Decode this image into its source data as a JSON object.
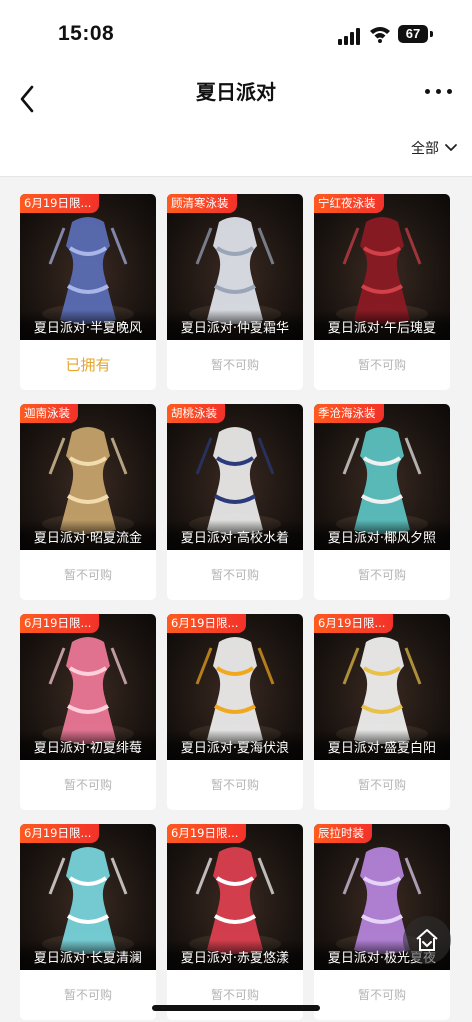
{
  "status_bar": {
    "time": "15:08",
    "battery": "67"
  },
  "header": {
    "title": "夏日派对"
  },
  "filter": {
    "label": "全部"
  },
  "items": [
    {
      "tag": "6月19日限...",
      "name": "夏日派对·半夏晚风",
      "status": "已拥有",
      "owned": true,
      "outfit": "#5b6fb8",
      "accent": "#a9b6e8"
    },
    {
      "tag": "顾清寒泳装",
      "name": "夏日派对·仲夏霜华",
      "status": "暂不可购",
      "owned": false,
      "outfit": "#e2e6ee",
      "accent": "#9aa6b8"
    },
    {
      "tag": "宁红夜泳装",
      "name": "夏日派对·午后瑰夏",
      "status": "暂不可购",
      "owned": false,
      "outfit": "#8e1a24",
      "accent": "#d2404a"
    },
    {
      "tag": "迦南泳装",
      "name": "夏日派对·昭夏流金",
      "status": "暂不可购",
      "owned": false,
      "outfit": "#c9a66e",
      "accent": "#f2dcae"
    },
    {
      "tag": "胡桃泳装",
      "name": "夏日派对·高校水着",
      "status": "暂不可购",
      "owned": false,
      "outfit": "#eeeeee",
      "accent": "#2a3a7a"
    },
    {
      "tag": "季沧海泳装",
      "name": "夏日派对·椰风夕照",
      "status": "暂不可购",
      "owned": false,
      "outfit": "#5cc6c4",
      "accent": "#f0f0f0"
    },
    {
      "tag": "6月19日限...",
      "name": "夏日派对·初夏绯莓",
      "status": "暂不可购",
      "owned": false,
      "outfit": "#f07a9a",
      "accent": "#ffd0dc"
    },
    {
      "tag": "6月19日限...",
      "name": "夏日派对·夏海伏浪",
      "status": "暂不可购",
      "owned": false,
      "outfit": "#f1f1f1",
      "accent": "#f0a81e"
    },
    {
      "tag": "6月19日限...",
      "name": "夏日派对·盛夏白阳",
      "status": "暂不可购",
      "owned": false,
      "outfit": "#f4f4f4",
      "accent": "#e8c04a"
    },
    {
      "tag": "6月19日限...",
      "name": "夏日派对·长夏清澜",
      "status": "暂不可购",
      "owned": false,
      "outfit": "#7ad8e0",
      "accent": "#ffffff"
    },
    {
      "tag": "6月19日限...",
      "name": "夏日派对·赤夏悠漾",
      "status": "暂不可购",
      "owned": false,
      "outfit": "#e04050",
      "accent": "#ffffff"
    },
    {
      "tag": "辰拉时装",
      "name": "夏日派对·极光夏夜",
      "status": "暂不可购",
      "owned": false,
      "outfit": "#b886e0",
      "accent": "#e6d4f6"
    }
  ]
}
